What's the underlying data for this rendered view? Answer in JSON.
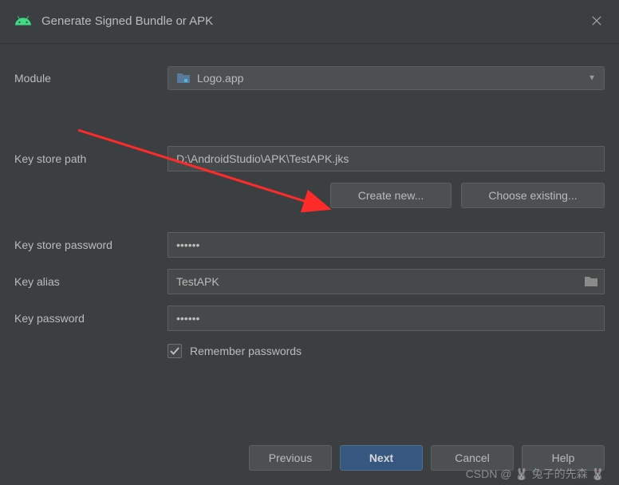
{
  "title": "Generate Signed Bundle or APK",
  "module": {
    "label": "Module",
    "value": "Logo.app"
  },
  "keystore_path": {
    "label": "Key store path",
    "value": "D:\\AndroidStudio\\APK\\TestAPK.jks"
  },
  "buttons": {
    "create_new": "Create new...",
    "choose_existing": "Choose existing..."
  },
  "keystore_password": {
    "label": "Key store password",
    "value": "••••••"
  },
  "key_alias": {
    "label": "Key alias",
    "value": "TestAPK"
  },
  "key_password": {
    "label": "Key password",
    "value": "••••••"
  },
  "remember": {
    "label": "Remember passwords",
    "checked": true
  },
  "footer": {
    "previous": "Previous",
    "next": "Next",
    "cancel": "Cancel",
    "help": "Help"
  },
  "watermark": "CSDN @ 🐰 兔子的先森 🐰"
}
